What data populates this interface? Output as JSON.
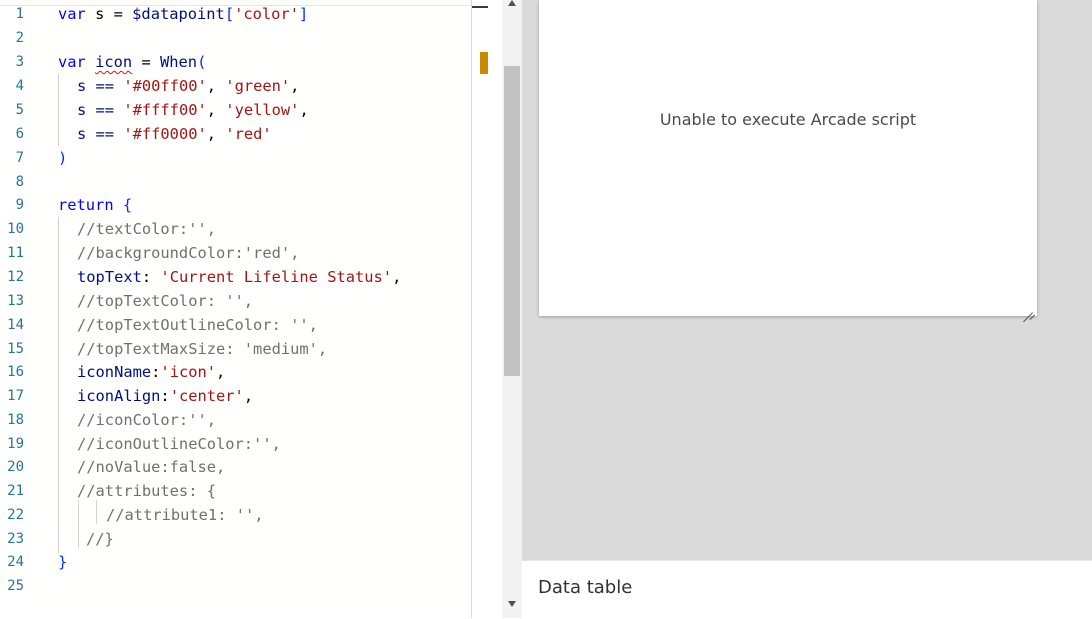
{
  "editor": {
    "lines": [
      {
        "n": "1"
      },
      {
        "n": "2"
      },
      {
        "n": "3"
      },
      {
        "n": "4"
      },
      {
        "n": "5"
      },
      {
        "n": "6"
      },
      {
        "n": "7"
      },
      {
        "n": "8"
      },
      {
        "n": "9"
      },
      {
        "n": "10"
      },
      {
        "n": "11"
      },
      {
        "n": "12"
      },
      {
        "n": "13"
      },
      {
        "n": "14"
      },
      {
        "n": "15"
      },
      {
        "n": "16"
      },
      {
        "n": "17"
      },
      {
        "n": "18"
      },
      {
        "n": "19"
      },
      {
        "n": "20"
      },
      {
        "n": "21"
      },
      {
        "n": "22"
      },
      {
        "n": "23"
      },
      {
        "n": "24"
      },
      {
        "n": "25"
      }
    ],
    "code": {
      "l1": [
        "var",
        " s = ",
        "$datapoint",
        "[",
        "'color'",
        "]"
      ],
      "l3": [
        "var",
        " ",
        "icon",
        " = ",
        "When",
        "("
      ],
      "l4": [
        "s == ",
        "'#00ff00'",
        ", ",
        "'green'",
        ","
      ],
      "l5": [
        "s == ",
        "'#ffff00'",
        ", ",
        "'yellow'",
        ","
      ],
      "l6": [
        "s == ",
        "'#ff0000'",
        ", ",
        "'red'"
      ],
      "l7": [
        ")"
      ],
      "l9": [
        "return",
        " ",
        "{"
      ],
      "l10": [
        "//textColor:'',"
      ],
      "l11": [
        "//backgroundColor:'red',"
      ],
      "l12": [
        "topText",
        ": ",
        "'Current Lifeline Status'",
        ","
      ],
      "l13": [
        "//topTextColor: '',"
      ],
      "l14": [
        "//topTextOutlineColor: '',"
      ],
      "l15": [
        "//topTextMaxSize: 'medium',"
      ],
      "l16": [
        "iconName",
        ":",
        "'icon'",
        ","
      ],
      "l17": [
        "iconAlign",
        ":",
        "'center'",
        ","
      ],
      "l18": [
        "//iconColor:'',"
      ],
      "l19": [
        "//iconOutlineColor:'',"
      ],
      "l20": [
        "//noValue:false,"
      ],
      "l21": [
        "//attributes: {"
      ],
      "l22": [
        "//attribute1: '',"
      ],
      "l23": [
        "//}"
      ],
      "l24": [
        "}"
      ]
    }
  },
  "preview": {
    "error_message": "Unable to execute Arcade script",
    "data_table_label": "Data table"
  },
  "colors": {
    "keyword": "#0000ff",
    "string": "#a31515",
    "line_number": "#237893",
    "ruler_marker": "#c98a00",
    "preview_bg": "#dadada"
  }
}
